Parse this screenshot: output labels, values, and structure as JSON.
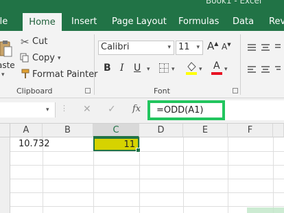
{
  "window": {
    "title": "Book1 - Excel"
  },
  "tabs": [
    {
      "label": "ile"
    },
    {
      "label": "Home"
    },
    {
      "label": "Insert"
    },
    {
      "label": "Page Layout"
    },
    {
      "label": "Formulas"
    },
    {
      "label": "Data"
    },
    {
      "label": "Revi"
    }
  ],
  "clipboard": {
    "paste_label": "aste",
    "cut_label": "Cut",
    "copy_label": "Copy",
    "format_painter_label": "Format Painter",
    "group_label": "Clipboard"
  },
  "font": {
    "name": "Calibri",
    "size": "11",
    "grow": "A",
    "shrink": "A",
    "bold": "B",
    "italic": "I",
    "underline": "U",
    "font_color_glyph": "A",
    "group_label": "Font",
    "fill_color": "#ffff00",
    "text_color": "#e81123"
  },
  "formula_bar": {
    "fx": "fx",
    "formula": "=ODD(A1)",
    "highlight_color": "#22c55e"
  },
  "sheet": {
    "columns": [
      "A",
      "B",
      "C",
      "D",
      "E",
      "F"
    ],
    "selected_column": "C",
    "cells": {
      "A1": "10.732",
      "C1": "11"
    },
    "selected_cell_fill": "#d6d300",
    "accent": "#217346"
  }
}
